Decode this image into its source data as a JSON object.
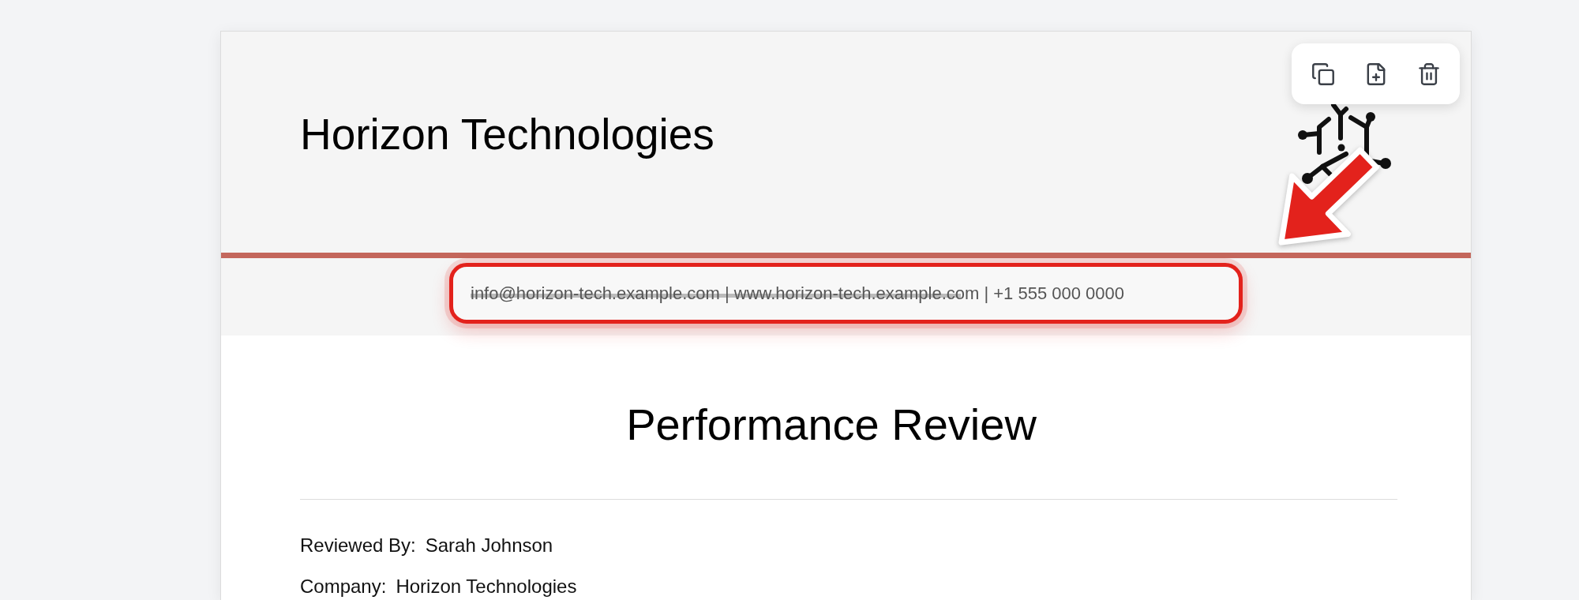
{
  "header": {
    "company": "Horizon Technologies",
    "contact": {
      "text": "info@horizon-tech.example.com | www.horizon-tech.example.com | +1 555 000 0000",
      "highlighted": true,
      "scribbled": true
    }
  },
  "document": {
    "title": "Performance Review",
    "fields": [
      {
        "label": "Reviewed By:",
        "value": "Sarah Johnson"
      },
      {
        "label": "Company:",
        "value": "Horizon Technologies"
      }
    ]
  }
}
